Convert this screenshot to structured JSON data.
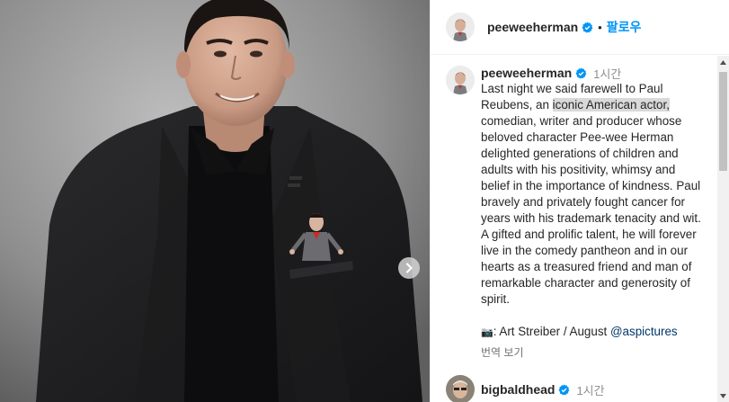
{
  "post_author": {
    "username": "peeweeherman",
    "verified": true,
    "follow_label": "팔로우",
    "separator": "•"
  },
  "caption": {
    "username": "peeweeherman",
    "time": "1시간",
    "text_before": "Last night we said farewell to Paul Reubens, an ",
    "text_highlight": "iconic American actor,",
    "text_after": " comedian, writer and producer whose beloved character Pee-wee Herman delighted generations of children and adults with his positivity, whimsy and belief in the importance of kindness. Paul bravely and privately fought cancer for years with his trademark tenacity and wit. A gifted and prolific talent, he will forever live in the comedy pantheon and in our hearts as a treasured friend and man of remarkable character and generosity of spirit.",
    "credit_icon": "camera-icon",
    "credit_icon_glyph": "📷",
    "credit_text": ": Art Streiber / August ",
    "credit_mention": "@aspictures",
    "translate_label": "번역 보기"
  },
  "next_comment": {
    "username": "bigbaldhead",
    "verified": true,
    "time": "1시간"
  },
  "icons": {
    "carousel_next": "chevron-right-icon",
    "verified": "verified-badge-icon"
  },
  "colors": {
    "accent": "#0095f6",
    "verified": "#0095f6",
    "mention": "#00376b",
    "muted": "#8e8e8e"
  }
}
